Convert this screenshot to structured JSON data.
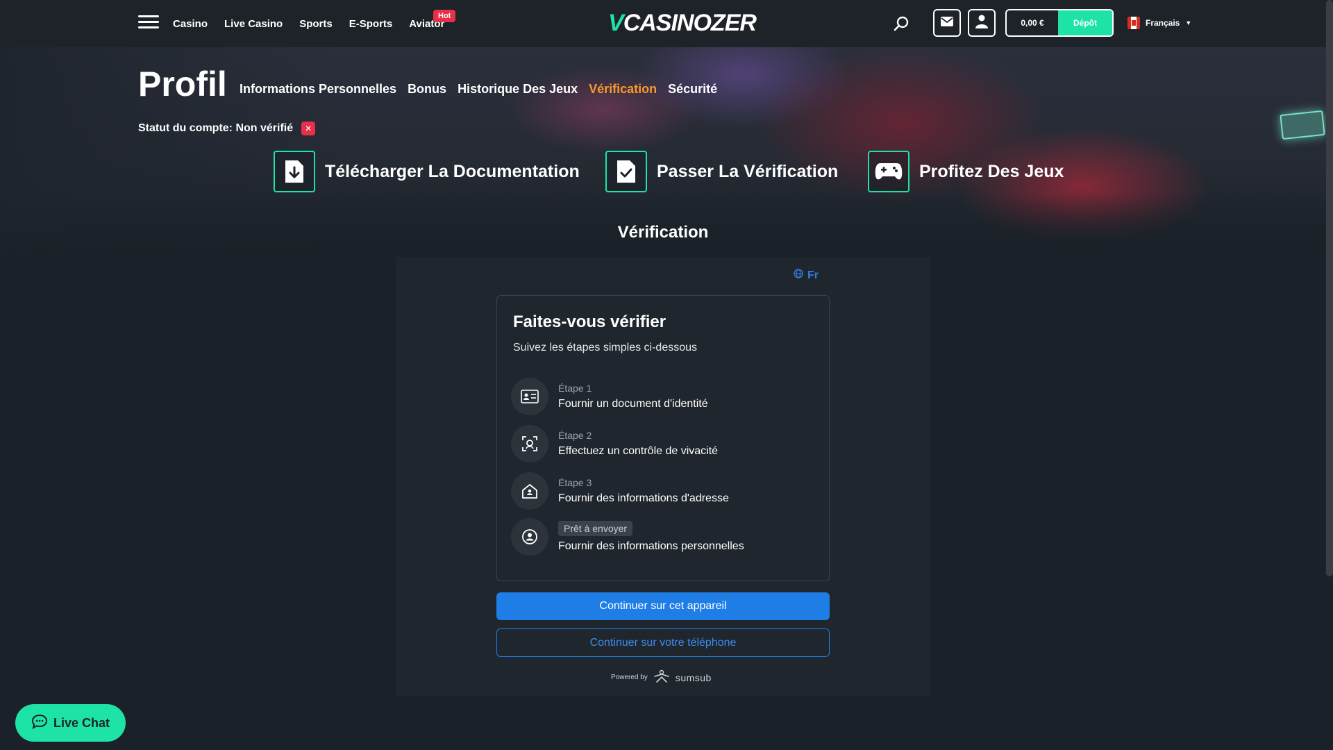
{
  "nav": {
    "items": [
      "Casino",
      "Live Casino",
      "Sports",
      "E-Sports",
      "Aviator"
    ],
    "hot_badge": "Hot"
  },
  "logo": {
    "text": "CASINOZER",
    "mark": "V"
  },
  "header": {
    "balance": "0,00 €",
    "deposit_label": "Dépôt",
    "language": "Français"
  },
  "profile": {
    "title": "Profil",
    "tabs": [
      "Informations Personnelles",
      "Bonus",
      "Historique Des Jeux",
      "Vérification",
      "Sécurité"
    ],
    "active_tab": "Vérification",
    "status_text": "Statut du compte: Non vérifié",
    "status_icon": "✕"
  },
  "steps_bar": [
    {
      "label": "Télécharger La Documentation",
      "icon": "file-download-icon"
    },
    {
      "label": "Passer La Vérification",
      "icon": "file-check-icon"
    },
    {
      "label": "Profitez Des Jeux",
      "icon": "gamepad-icon"
    }
  ],
  "section_title": "Vérification",
  "widget": {
    "language": "Fr",
    "title": "Faites-vous vérifier",
    "subtitle": "Suivez les étapes simples ci-dessous",
    "steps": [
      {
        "label": "Étape 1",
        "text": "Fournir un document d'identité",
        "icon": "id-card-icon"
      },
      {
        "label": "Étape 2",
        "text": "Effectuez un contrôle de vivacité",
        "icon": "face-scan-icon"
      },
      {
        "label": "Étape 3",
        "text": "Fournir des informations d'adresse",
        "icon": "home-icon"
      },
      {
        "badge": "Prêt à envoyer",
        "text": "Fournir des informations personnelles",
        "icon": "person-icon"
      }
    ],
    "primary_button": "Continuer sur cet appareil",
    "secondary_button": "Continuer sur votre téléphone",
    "powered_by": "Powered by",
    "provider": "sumsub"
  },
  "live_chat": "Live Chat",
  "colors": {
    "accent": "#1de3a7",
    "active_tab": "#f79a2c",
    "primary_blue": "#1f7de6",
    "danger": "#e8304a"
  }
}
